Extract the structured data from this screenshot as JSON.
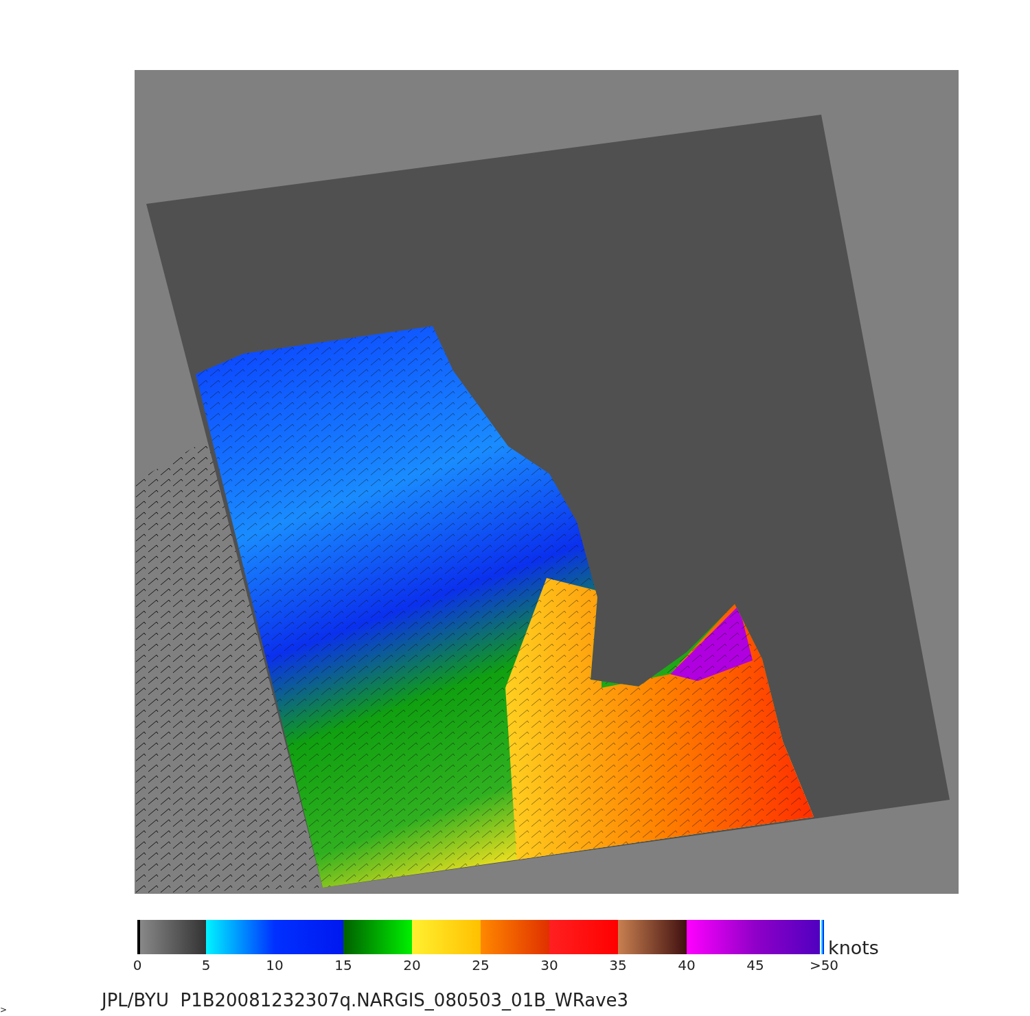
{
  "colorbar": {
    "ticks": [
      "0",
      "5",
      "10",
      "15",
      "20",
      "25",
      "30",
      "35",
      "40",
      "45",
      ">50"
    ],
    "unit": "knots"
  },
  "caption": "JPL/BYU  P1B20081232307q.NARGIS_080503_01B_WRave3",
  "corner_mark": ">"
}
